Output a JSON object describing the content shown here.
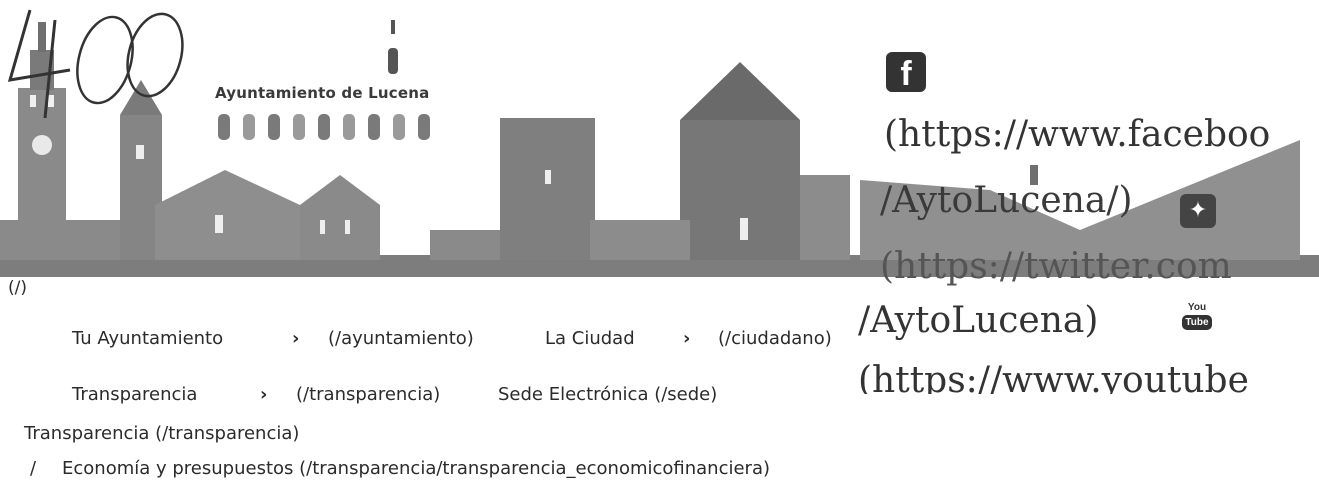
{
  "header": {
    "city_name": "Ayuntamiento de Lucena",
    "home_link": "(/)",
    "handwritten_mark": "400"
  },
  "social": {
    "facebook_icon": "facebook-icon",
    "facebook_url_1": "(https://www.faceboo",
    "facebook_url_2": "/AytoLucena/)",
    "twitter_icon": "twitter-icon",
    "twitter_url_1": "(https://twitter.com",
    "twitter_url_2": "/AytoLucena)",
    "youtube_icon": "youtube-icon",
    "youtube_label_top": "You",
    "youtube_label_bottom": "Tube",
    "youtube_url": "(https://www.youtube"
  },
  "nav": {
    "items": [
      {
        "label": "Tu Ayuntamiento",
        "url": "(/ayuntamiento)",
        "has_submenu": true
      },
      {
        "label": "La Ciudad",
        "url": "(/ciudadano)",
        "has_submenu": true
      },
      {
        "label": "Transparencia",
        "url": "(/transparencia)",
        "has_submenu": true
      },
      {
        "label": "Sede Electrónica (/sede)",
        "url": "",
        "has_submenu": false
      }
    ],
    "chevron": "›"
  },
  "breadcrumb": {
    "level1": "Transparencia (/transparencia)",
    "separator": "/",
    "level2": "Economía y presupuestos (/transparencia/transparencia_economicofinanciera)"
  },
  "colors": {
    "silhouette": "#8a8a8a",
    "silhouette_dark": "#6f6f6f",
    "text": "#2b2b2b"
  }
}
